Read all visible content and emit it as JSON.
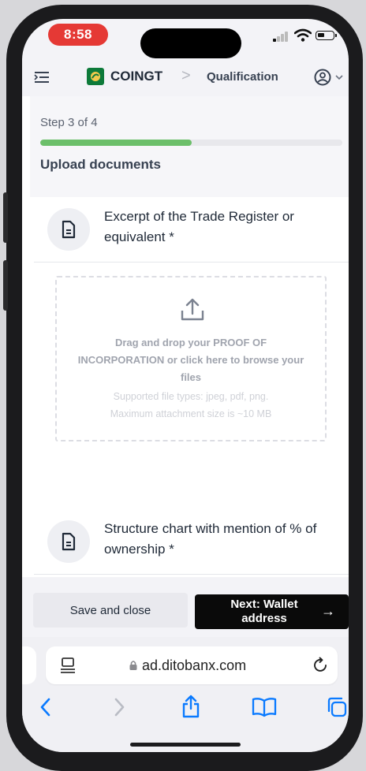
{
  "status_bar": {
    "time": "8:58",
    "time_pill_color": "#e53935"
  },
  "header": {
    "menu_icon": "collapse-menu-icon",
    "brand": "COINGT",
    "brand_logo_color": "#0d7a3a",
    "breadcrumb_separator": ">",
    "page": "Qualification",
    "user_icon": "user-circle-icon"
  },
  "progress": {
    "step_text": "Step 3 of 4",
    "fraction": 0.5,
    "fill_color": "#6cbf6a",
    "section_title": "Upload documents"
  },
  "documents": [
    {
      "icon": "document-icon",
      "title": "Excerpt of the Trade Register or equivalent *"
    },
    {
      "icon": "document-icon",
      "title": "Structure chart with mention of % of ownership *"
    }
  ],
  "dropzone": {
    "icon": "upload-icon",
    "instruction": "Drag and drop your PROOF OF INCORPORATION or click here to browse your files",
    "supported_types": "Supported file types: jpeg, pdf, png.",
    "max_size": "Maximum attachment size is ~10 MB"
  },
  "actions": {
    "save_label": "Save and close",
    "next_label": "Next: Wallet address",
    "next_arrow": "→"
  },
  "browser": {
    "url": "ad.ditobanx.com",
    "reader_icon": "reader-icon",
    "lock_icon": "lock-icon",
    "reload_icon": "reload-icon",
    "toolbar": [
      "back-icon",
      "forward-icon",
      "share-icon",
      "bookmarks-icon",
      "tabs-icon"
    ],
    "accent_color": "#0a7aff"
  }
}
